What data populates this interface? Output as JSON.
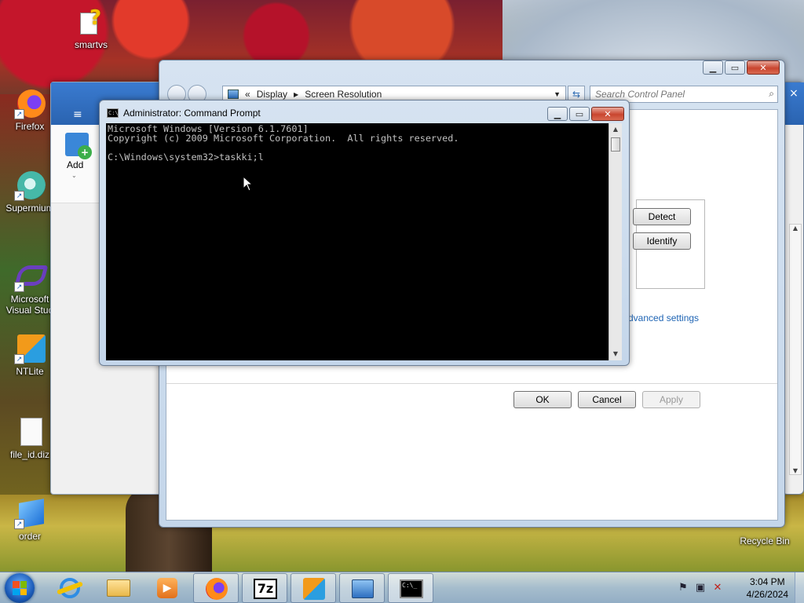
{
  "desktop": {
    "icons": [
      {
        "label": "smartvs",
        "icon": "help-file-icon"
      },
      {
        "label": "Firefox",
        "icon": "firefox-icon"
      },
      {
        "label": "Supermium",
        "icon": "supermium-icon"
      },
      {
        "label": "Microsoft Visual Stud",
        "icon": "visual-studio-icon"
      },
      {
        "label": "NTLite",
        "icon": "ntlite-icon"
      },
      {
        "label": "file_id.diz",
        "icon": "text-file-icon"
      },
      {
        "label": "order",
        "icon": "cube-icon"
      },
      {
        "label": "Recycle Bin",
        "icon": "recycle-bin-icon"
      }
    ]
  },
  "control_panel": {
    "breadcrumb_prefix": "«",
    "breadcrumb": [
      "Display",
      "Screen Resolution"
    ],
    "search_placeholder": "Search Control Panel",
    "detect_label": "Detect",
    "identify_label": "Identify",
    "advanced_link": "dvanced settings",
    "ok_label": "OK",
    "cancel_label": "Cancel",
    "apply_label": "Apply"
  },
  "side_window": {
    "menu_glyph": "≡",
    "add_label": "Add"
  },
  "cmd": {
    "title": "Administrator: Command Prompt",
    "lines": [
      "Microsoft Windows [Version 6.1.7601]",
      "Copyright (c) 2009 Microsoft Corporation.  All rights reserved.",
      "",
      "C:\\Windows\\system32>taskki;l"
    ]
  },
  "taskbar": {
    "items": [
      {
        "name": "internet-explorer",
        "icon": "internet-explorer-icon"
      },
      {
        "name": "explorer",
        "icon": "folder-icon"
      },
      {
        "name": "media-player",
        "icon": "media-player-icon"
      },
      {
        "name": "firefox",
        "icon": "firefox-icon"
      },
      {
        "name": "7zip",
        "icon": "7zip-icon",
        "text": "7z"
      },
      {
        "name": "ntlite",
        "icon": "ntlite-icon"
      },
      {
        "name": "control-panel",
        "icon": "control-panel-icon"
      },
      {
        "name": "command-prompt",
        "icon": "command-prompt-icon"
      }
    ],
    "time": "3:04 PM",
    "date": "4/26/2024"
  },
  "colors": {
    "accent": "#2a63b0",
    "console_bg": "#000000",
    "console_fg": "#c0c0c0",
    "link": "#1e64b4"
  }
}
